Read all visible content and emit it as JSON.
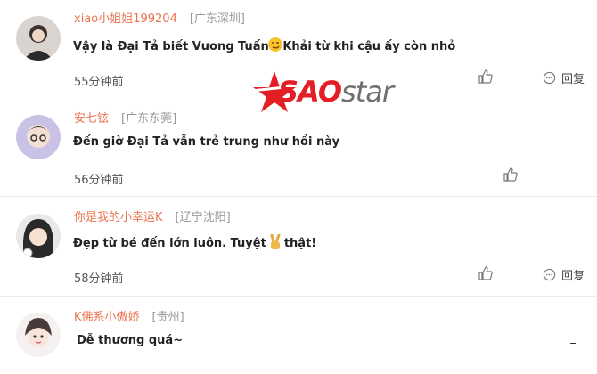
{
  "comments": [
    {
      "username": "xiao小姐姐199204",
      "location": "[广东深圳]",
      "text_a": "Vậy là Đại Tả biết Vương Tuấn ",
      "text_b": "hải từ khi cậu ấy còn nhỏ",
      "emoji": "smirk-emoji",
      "time": "55分钟前",
      "reply": "回复"
    },
    {
      "username": "安七铉",
      "location": "[广东东莞]",
      "text": "Đến giờ Đại Tả vẫn trẻ trung như hồi này",
      "time": "56分钟前"
    },
    {
      "username": "你是我的小幸运K",
      "location": "[辽宁沈阳]",
      "text_a": "Đẹp từ bé đến lớn luôn. Tuyệt",
      "text_b": "thật!",
      "emoji": "victory-hand-emoji",
      "time": "58分钟前",
      "reply": "回复"
    },
    {
      "username": "K佛系小傲娇",
      "location": "[贵州]",
      "text": "Dễ thương quá~"
    }
  ],
  "watermark": {
    "sao": "SAO",
    "star": "star"
  },
  "colors": {
    "username": "#eb7350",
    "brand_red": "#e31e24"
  }
}
